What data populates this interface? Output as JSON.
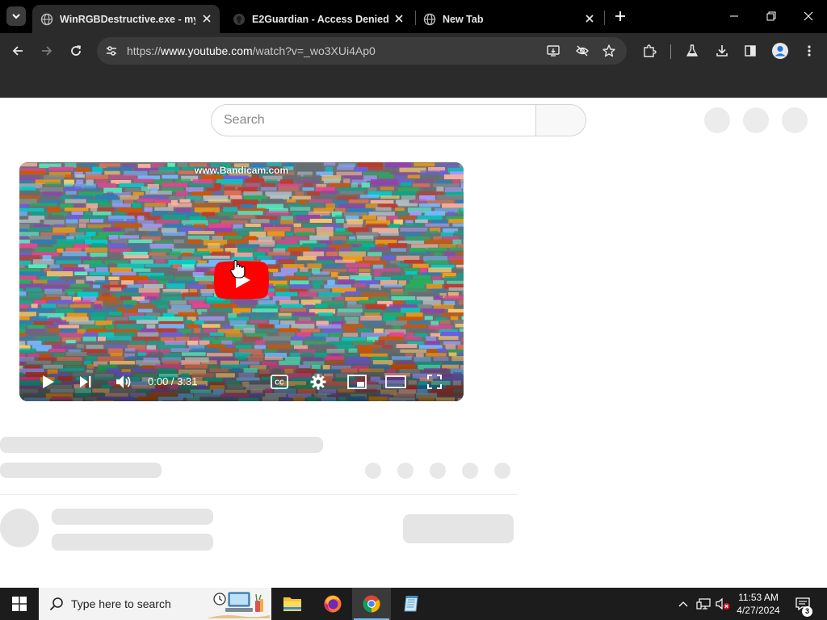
{
  "browser": {
    "tabs": [
      {
        "title": "WinRGBDestructive.exe - my n",
        "favicon": "globe-icon",
        "active": true
      },
      {
        "title": "E2Guardian - Access Denied",
        "favicon": "github-icon",
        "active": false
      },
      {
        "title": "New Tab",
        "favicon": "globe-icon",
        "active": false
      }
    ],
    "address": {
      "scheme": "https://",
      "host": "www.youtube.com",
      "path": "/watch?v=_wo3XUi4Ap0"
    },
    "theme": {
      "frame": "#000000",
      "toolbar": "#2b2b2b",
      "omnibox": "#3b3b3b"
    }
  },
  "youtube": {
    "search_placeholder": "Search",
    "player": {
      "watermark": "www.Bandicam.com",
      "time_current": "0:00",
      "time_separator": " / ",
      "time_total": "3:31",
      "play_button_color": "#ff0000"
    }
  },
  "taskbar": {
    "search_placeholder": "Type here to search",
    "time": "11:53 AM",
    "date": "4/27/2024",
    "notification_count": "3",
    "pinned": [
      "file-explorer-icon",
      "firefox-icon",
      "chrome-icon",
      "notepad-icon"
    ]
  }
}
